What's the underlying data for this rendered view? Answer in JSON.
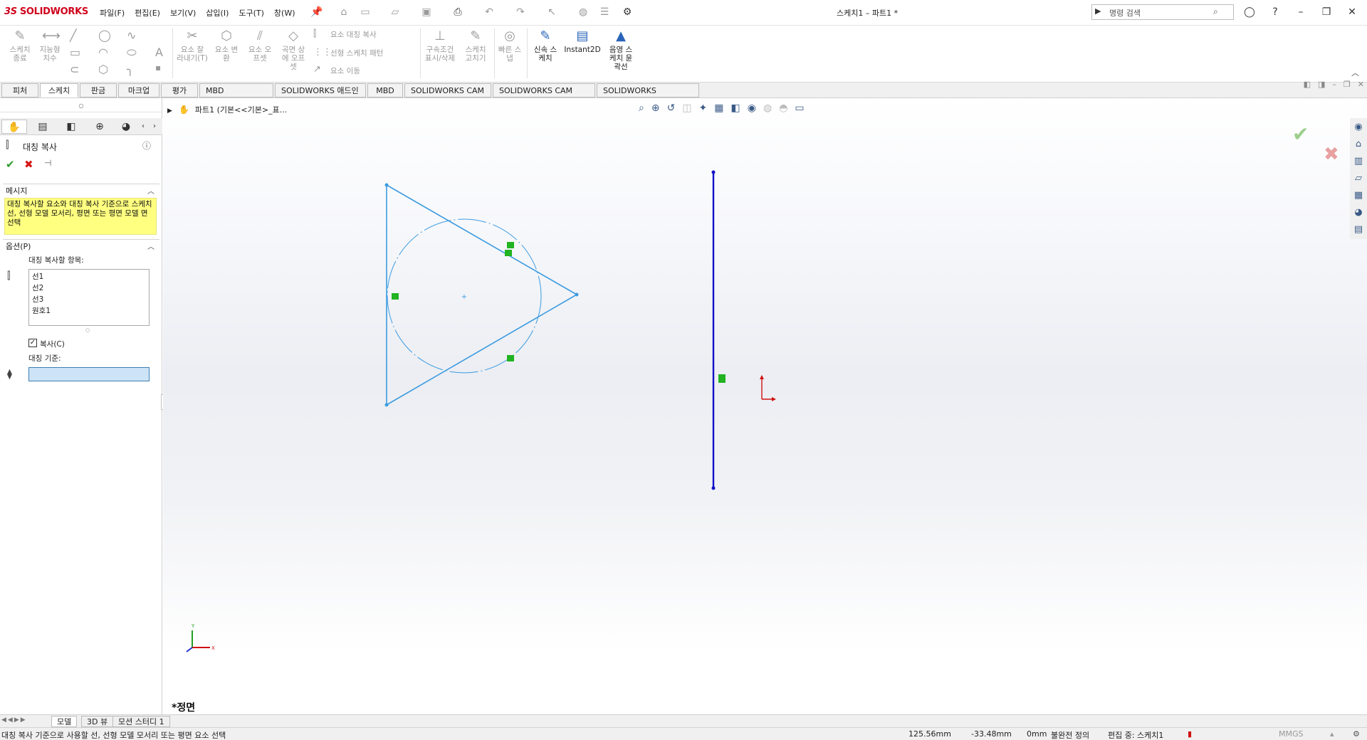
{
  "app": {
    "brand": "SOLIDWORKS",
    "brand_prefix": "3S",
    "doc_title": "스케치1 – 파트1 *"
  },
  "menu": [
    "파일(F)",
    "편집(E)",
    "보기(V)",
    "삽입(I)",
    "도구(T)",
    "창(W)"
  ],
  "search": {
    "placeholder": "명령 검색"
  },
  "ribbon": {
    "sketch_exit": "스케치\n종료",
    "smart_dim": "지능형\n치수",
    "trim": "요소 잘\n라내기(T)",
    "convert": "요소 변\n환",
    "offset": "요소 오\n프셋",
    "surface_offset": "곡면 상\n에 오프\n셋",
    "mirror_entities": "요소 대칭 복사",
    "linear_pattern": "선형 스케치 패턴",
    "move_entities": "요소 이동",
    "relations": "구속조건\n표시/삭제",
    "repair": "스케치\n고치기",
    "rapid_snap": "빠른 스\n냅",
    "rapid_sketch": "신속 스\n케치",
    "instant2d": "Instant2D",
    "shaded_contours": "음영 스\n케치 윤\n곽선"
  },
  "tabs": [
    "피처",
    "스케치",
    "판금",
    "마크업",
    "평가",
    "MBD Dimensions",
    "SOLIDWORKS 애드인",
    "MBD",
    "SOLIDWORKS CAM",
    "SOLIDWORKS CAM TBM",
    "SOLIDWORKS Inspection"
  ],
  "selected_tab": "스케치",
  "panel": {
    "title": "대칭 복사",
    "message_header": "메시지",
    "message": "대칭 복사할 요소와 대칭 복사 기준으로 스케치 선, 선형 모델 모서리, 평면 또는 평면 모델 면 선택",
    "options_header": "옵션(P)",
    "entities_label": "대칭 복사할 항목:",
    "entities": [
      "선1",
      "선2",
      "선3",
      "원호1"
    ],
    "copy_label": "복사(C)",
    "copy_checked": true,
    "mirror_about_label": "대칭 기준:"
  },
  "tree": {
    "label": "파트1  (기본<<기본>_표..."
  },
  "view_name": "*정면",
  "bottom_tabs": [
    "모델",
    "3D 뷰",
    "모션 스터디 1"
  ],
  "status": {
    "prompt": "대칭 복사 기준으로 사용할 선, 선형 모델 모서리 또는 평면 요소 선택",
    "x": "125.56mm",
    "y": "-33.48mm",
    "z": "0mm",
    "state": "불완전 정의",
    "editing": "편집 중: 스케치1",
    "units": "MMGS"
  },
  "colors": {
    "sketch_blue": "#3c9be0",
    "centerline_blue": "#1010c8",
    "relation_green": "#21b321",
    "origin_red": "#d01010",
    "message_yellow": "#ffff80"
  }
}
